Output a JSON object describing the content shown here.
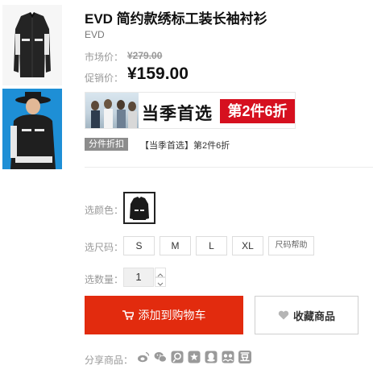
{
  "product": {
    "title": "EVD 简约款绣标工装长袖衬衫",
    "brand": "EVD"
  },
  "thumbnails": [
    {
      "icon": "shirt-product-photo"
    },
    {
      "icon": "model-product-photo"
    }
  ],
  "price": {
    "market_label": "市场价：",
    "market_value": "¥279.00",
    "sale_label": "促销价：",
    "sale_value": "¥159.00"
  },
  "banner": {
    "main_text": "当季首选",
    "tag_text": "第2件6折"
  },
  "promo": {
    "badge": "分件折扣",
    "text": "【当季首选】第2件6折"
  },
  "color": {
    "label": "选颜色：",
    "selected_icon": "black-shirt-swatch"
  },
  "size": {
    "label": "选尺码：",
    "options": [
      "S",
      "M",
      "L",
      "XL"
    ],
    "help": "尺码帮助"
  },
  "quantity": {
    "label": "选数量：",
    "value": "1"
  },
  "actions": {
    "add_to_cart": "添加到购物车",
    "favorite": "收藏商品"
  },
  "share": {
    "label": "分享商品：",
    "icons": [
      "weibo-icon",
      "wechat-icon",
      "qzone-icon",
      "star-icon",
      "qq-icon",
      "renren-icon",
      "douban-icon"
    ],
    "douban_glyph": "豆"
  },
  "colors": {
    "cart_red": "#e22b0e",
    "banner_red": "#d6101f",
    "badge_gray": "#8c8c8c"
  }
}
